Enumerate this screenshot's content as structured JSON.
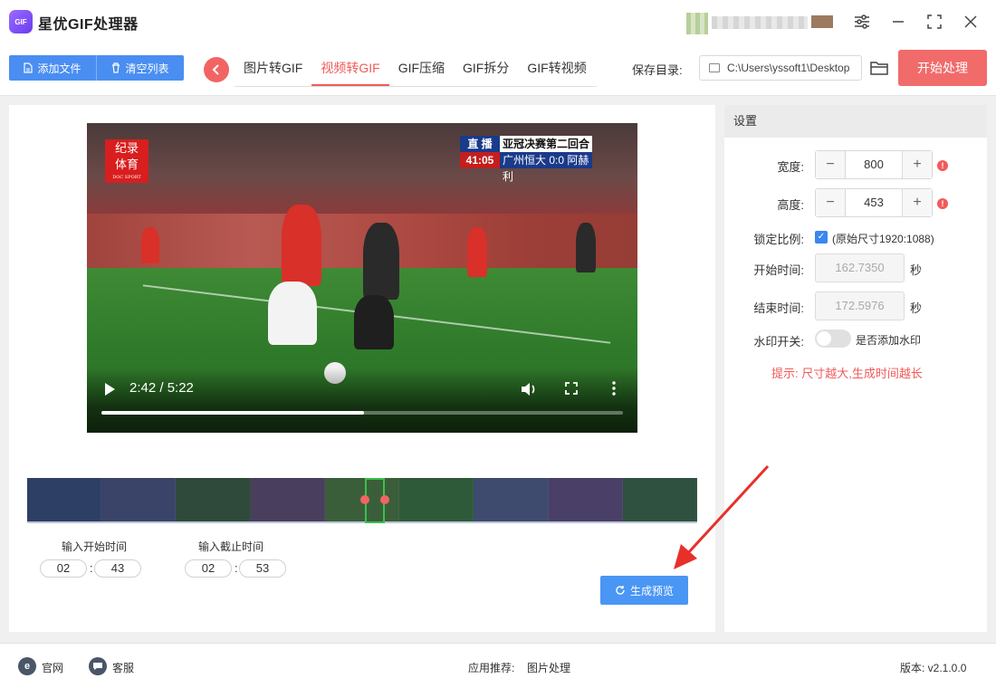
{
  "app": {
    "title": "星优GIF处理器",
    "logo_text": "GIF"
  },
  "window_controls": [
    "settings-icon",
    "minimize-icon",
    "maximize-icon",
    "close-icon"
  ],
  "toolbar": {
    "add_file": "添加文件",
    "clear_list": "清空列表",
    "tabs": [
      {
        "label": "图片转GIF",
        "active": false
      },
      {
        "label": "视频转GIF",
        "active": true
      },
      {
        "label": "GIF压缩",
        "active": false
      },
      {
        "label": "GIF拆分",
        "active": false
      },
      {
        "label": "GIF转视频",
        "active": false
      }
    ],
    "save_dir_label": "保存目录:",
    "save_dir_value": "C:\\Users\\yssoft1\\Desktop",
    "start_button": "开始处理"
  },
  "video": {
    "logo_line1": "纪录",
    "logo_line2": "体育",
    "logo_en": "DOC SPORT",
    "score_live": "直 播",
    "score_competition": "亚冠决赛第二回合",
    "score_clock": "41:05",
    "score_teams": "广州恒大 0:0 阿赫利",
    "time_display": "2:42 / 5:22",
    "progress": 0.503
  },
  "trim": {
    "start_label": "输入开始时间",
    "end_label": "输入截止时间",
    "start_min": "02",
    "start_sec": "43",
    "end_min": "02",
    "end_sec": "53",
    "preview_button": "生成预览"
  },
  "settings": {
    "header": "设置",
    "width_label": "宽度:",
    "width_value": "800",
    "height_label": "高度:",
    "height_value": "453",
    "lock_label": "锁定比例:",
    "lock_text": "(原始尺寸1920:1088)",
    "lock_checked": true,
    "start_label": "开始时间:",
    "start_value": "162.7350",
    "end_label": "结束时间:",
    "end_value": "172.5976",
    "unit": "秒",
    "watermark_label": "水印开关:",
    "watermark_text": "是否添加水印",
    "watermark_on": false,
    "tip": "提示: 尺寸越大,生成时间越长"
  },
  "footer": {
    "website": "官网",
    "support": "客服",
    "recommend": "应用推荐:",
    "recommend_item": "图片处理",
    "version": "版本: v2.1.0.0"
  },
  "colors": {
    "accent_blue": "#4a8ef2",
    "accent_red": "#f26464",
    "checkbox_blue": "#3b86f0"
  }
}
